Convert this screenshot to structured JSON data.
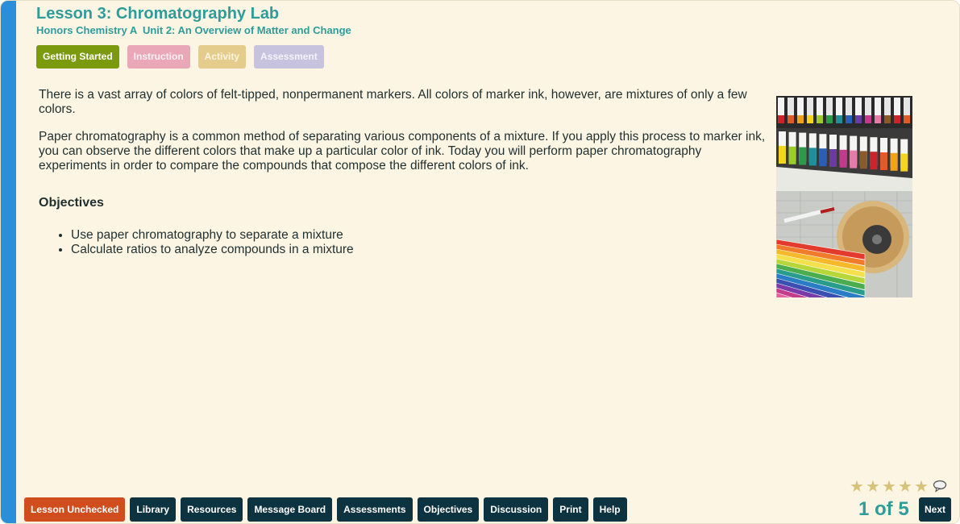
{
  "header": {
    "title": "Lesson 3: Chromatography Lab",
    "subtitle": "Honors Chemistry A  Unit 2: An Overview of Matter and Change"
  },
  "tabs": [
    {
      "label": "Getting Started",
      "active": true
    },
    {
      "label": "Instruction",
      "active": false
    },
    {
      "label": "Activity",
      "active": false
    },
    {
      "label": "Assessment",
      "active": false
    }
  ],
  "content": {
    "paragraphs": [
      "There is a vast array of colors of felt-tipped, nonpermanent markers. All colors of marker ink, however, are mixtures of only a few colors.",
      "Paper chromatography is a common method of separating various components of a mixture. If you apply this process to marker ink, you can observe the different colors that make up a particular color of ink. Today you will perform paper chromatography experiments in order to compare the compounds that compose the different colors of ink."
    ],
    "objectives_heading": "Objectives",
    "objectives": [
      "Use paper chromatography to separate a mixture",
      "Calculate ratios to analyze compounds in a mixture"
    ]
  },
  "footer": {
    "buttons": [
      "Lesson Unchecked",
      "Library",
      "Resources",
      "Message Board",
      "Assessments",
      "Objectives",
      "Discussion",
      "Print",
      "Help"
    ],
    "page_indicator": "1 of 5",
    "next_label": "Next",
    "rating_stars": 5
  },
  "colors": {
    "accent_teal": "#2f9c9a",
    "dark_button": "#0d3340",
    "left_bar": "#2a8fd8",
    "background": "#fdf5e3",
    "unchecked_button": "#d04d1e"
  }
}
